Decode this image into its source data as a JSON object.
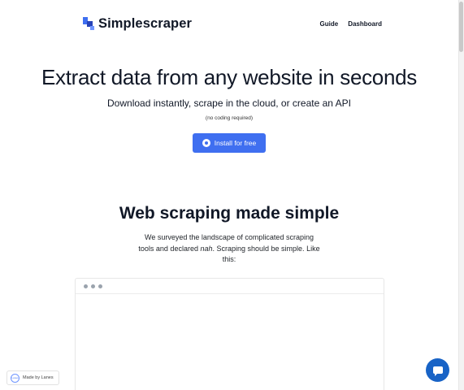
{
  "header": {
    "brand": "Simplescraper",
    "nav": [
      {
        "label": "Guide"
      },
      {
        "label": "Dashboard"
      }
    ]
  },
  "hero": {
    "title": "Extract data from any website in seconds",
    "subtitle": "Download instantly, scrape in the cloud, or create an API",
    "note": "(no coding required)",
    "install_button": "Install for free",
    "install_icon": "chrome-icon"
  },
  "section": {
    "title": "Web scraping made simple",
    "body_before": "We surveyed the landscape of complicated scraping tools and declared ",
    "body_emphasis": "nah",
    "body_after": ". Scraping should be simple. Like this:"
  },
  "badge": {
    "circle_text": "Lanes",
    "label": "Made by Lanes"
  },
  "colors": {
    "accent": "#3f6ff0",
    "chat": "#1863c6"
  }
}
